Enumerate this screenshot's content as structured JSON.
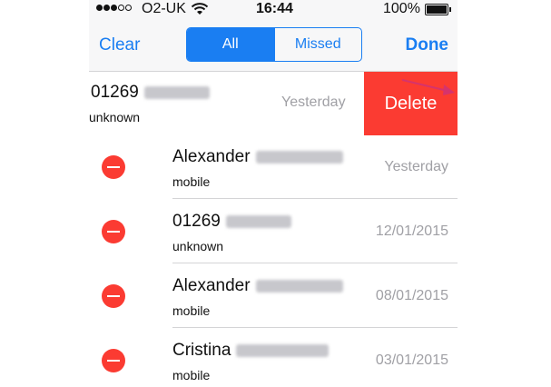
{
  "status": {
    "carrier": "O2-UK",
    "time": "16:44",
    "battery": "100%"
  },
  "nav": {
    "left_button": "Clear",
    "right_button": "Done",
    "segments": [
      "All",
      "Missed"
    ],
    "active_segment": "All"
  },
  "swiped_row": {
    "number": "01269",
    "type": "unknown",
    "time": "Yesterday",
    "delete_label": "Delete"
  },
  "rows": [
    {
      "name": "Alexander",
      "type": "mobile",
      "time": "Yesterday"
    },
    {
      "name": "01269",
      "type": "unknown",
      "time": "12/01/2015"
    },
    {
      "name": "Alexander",
      "type": "mobile",
      "time": "08/01/2015"
    },
    {
      "name": "Cristina",
      "type": "mobile",
      "time": "03/01/2015"
    }
  ],
  "colors": {
    "accent": "#1a7ef2",
    "delete": "#fb3b32",
    "secondary_text": "#a0a0a5",
    "annotation_arrow": "#d6336c"
  }
}
